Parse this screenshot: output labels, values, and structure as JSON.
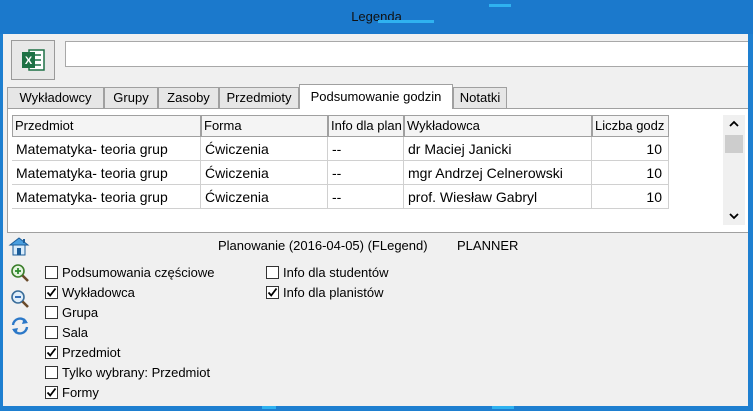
{
  "window": {
    "title": "Legenda"
  },
  "toolbar": {
    "excel_icon": "excel-icon",
    "input_value": ""
  },
  "tabs": [
    {
      "label": "Wykładowcy",
      "active": false
    },
    {
      "label": "Grupy",
      "active": false
    },
    {
      "label": "Zasoby",
      "active": false
    },
    {
      "label": "Przedmioty",
      "active": false
    },
    {
      "label": "Podsumowanie godzin",
      "active": true
    },
    {
      "label": "Notatki",
      "active": false
    }
  ],
  "table": {
    "columns": [
      "Przedmiot",
      "Forma",
      "Info dla plan",
      "Wykładowca",
      "Liczba godz"
    ],
    "rows": [
      [
        "Matematyka- teoria grup",
        "Ćwiczenia",
        "--",
        "dr Maciej Janicki",
        "10"
      ],
      [
        "Matematyka- teoria grup",
        "Ćwiczenia",
        "--",
        "mgr Andrzej Celnerowski",
        "10"
      ],
      [
        "Matematyka- teoria grup",
        "Ćwiczenia",
        "--",
        "prof. Wiesław Gabryl",
        "10"
      ]
    ]
  },
  "status": {
    "text": "Planowanie (2016-04-05) (FLegend)",
    "mode": "PLANNER"
  },
  "side_icons": [
    "home-icon",
    "zoom-in-icon",
    "zoom-out-icon",
    "refresh-icon"
  ],
  "options_left": [
    {
      "label": "Podsumowania częściowe",
      "checked": false
    },
    {
      "label": "Wykładowca",
      "checked": true
    },
    {
      "label": "Grupa",
      "checked": false
    },
    {
      "label": "Sala",
      "checked": false
    },
    {
      "label": "Przedmiot",
      "checked": true
    },
    {
      "label": "Tylko wybrany: Przedmiot",
      "checked": false
    },
    {
      "label": "Formy",
      "checked": true
    }
  ],
  "options_right": [
    {
      "label": "Info dla studentów",
      "checked": false
    },
    {
      "label": "Info dla planistów",
      "checked": true
    }
  ],
  "colors": {
    "titlebar": "#1b79cc",
    "accent": "#2fb2f0",
    "excel_green": "#1e7145"
  }
}
